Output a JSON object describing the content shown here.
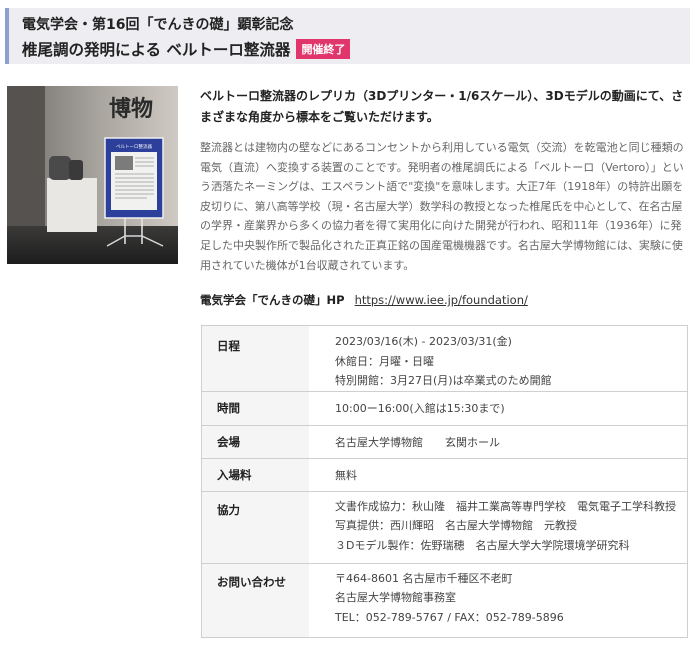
{
  "header": {
    "subtitle": "電気学会・第16回「でんきの礎」顕彰記念",
    "title": "椎尾調の発明による ベルトーロ整流器",
    "badge": "開催終了"
  },
  "photo": {
    "sign_text": "博物",
    "panel_title": "ベルトーロ整流器"
  },
  "lead": "ベルトーロ整流器のレプリカ（3Dプリンター・1/6スケール）、3Dモデルの動画にて、さまざまな角度から標本をご覧いただけます。",
  "description": "整流器とは建物内の壁などにあるコンセントから利用している電気（交流）を乾電池と同じ種類の電気（直流）へ変換する装置のことです。発明者の椎尾調氏による「ベルトーロ（Vertoro）」という洒落たネーミングは、エスペラント語で\"変換\"を意味します。大正7年（1918年）の特許出願を皮切りに、第八高等学校（現・名古屋大学）数学科の教授となった椎尾氏を中心として、在名古屋の学界・産業界から多くの協力者を得て実用化に向けた開発が行われ、昭和11年（1936年）に発足した中央製作所で製品化された正真正銘の国産電機機器です。名古屋大学博物館には、実験に使用されていた機体が1台収蔵されています。",
  "hp": {
    "label": "電気学会「でんきの礎」HP",
    "url": "https://www.iee.jp/foundation/"
  },
  "info": [
    {
      "key": "日程",
      "lines": [
        "2023/03/16(木) - 2023/03/31(金)",
        "休館日：月曜・日曜",
        "特別開館：3月27日(月)は卒業式のため開館"
      ]
    },
    {
      "key": "時間",
      "lines": [
        "10:00ー16:00(入館は15:30まで)"
      ]
    },
    {
      "key": "会場",
      "lines": [
        "名古屋大学博物館　　玄関ホール"
      ]
    },
    {
      "key": "入場料",
      "lines": [
        "無料"
      ]
    },
    {
      "key": "協力",
      "lines": [
        "文書作成協力：秋山隆　福井工業高等専門学校　電気電子工学科教授",
        "写真提供：西川輝昭　名古屋大学博物館　元教授",
        "３Dモデル製作：佐野瑞穂　名古屋大学大学院環境学研究科"
      ]
    },
    {
      "key": "お問い合わせ",
      "lines": [
        "〒464-8601 名古屋市千種区不老町",
        "名古屋大学博物館事務室",
        "TEL：052-789-5767 / FAX：052-789-5896"
      ]
    }
  ]
}
